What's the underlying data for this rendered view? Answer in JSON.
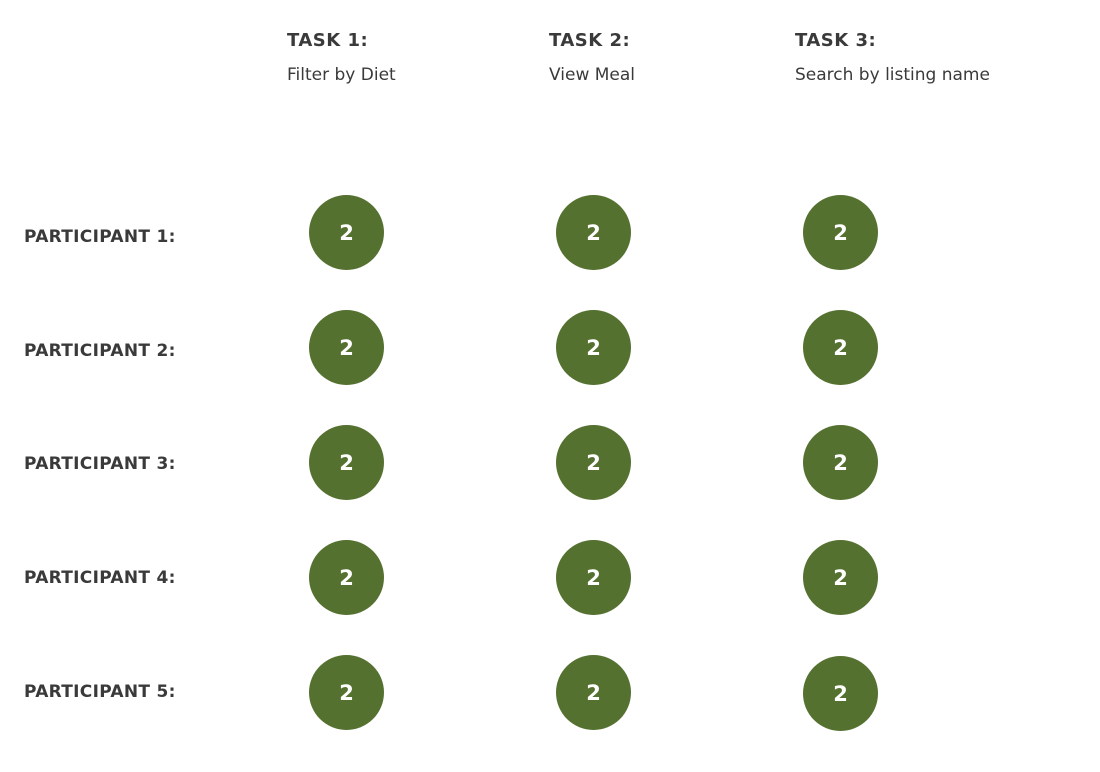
{
  "tasks": [
    {
      "title": "TASK 1:",
      "desc": "Filter by Diet"
    },
    {
      "title": "TASK 2:",
      "desc": "View Meal"
    },
    {
      "title": "TASK 3:",
      "desc": "Search by listing name"
    }
  ],
  "participants": [
    {
      "label": "PARTICIPANT 1:",
      "scores": [
        "2",
        "2",
        "2"
      ]
    },
    {
      "label": "PARTICIPANT 2:",
      "scores": [
        "2",
        "2",
        "2"
      ]
    },
    {
      "label": "PARTICIPANT 3:",
      "scores": [
        "2",
        "2",
        "2"
      ]
    },
    {
      "label": "PARTICIPANT 4:",
      "scores": [
        "2",
        "2",
        "2"
      ]
    },
    {
      "label": "PARTICIPANT 5:",
      "scores": [
        "2",
        "2",
        "2"
      ]
    }
  ],
  "colors": {
    "score_fill": "#557130",
    "text": "#3a3a3a"
  }
}
